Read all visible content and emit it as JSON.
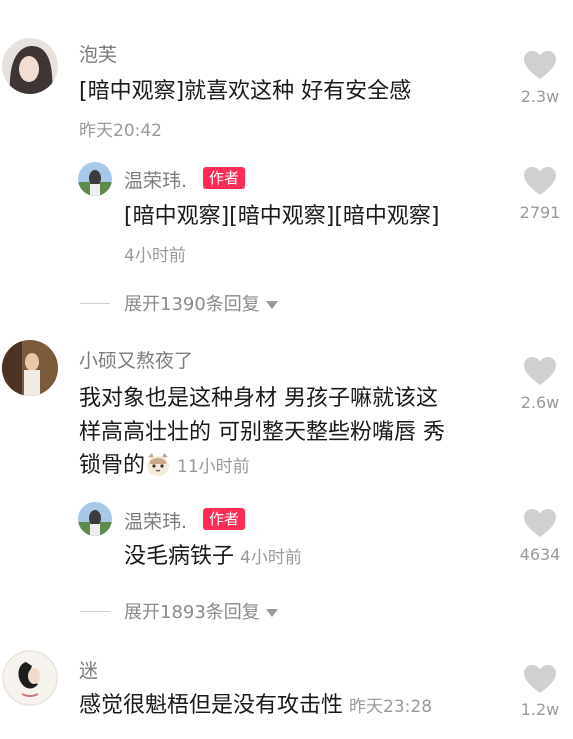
{
  "comments": [
    {
      "user": "泡芙",
      "text": "[暗中观察]就喜欢这种 好有安全感",
      "time": "昨天20:42",
      "likes": "2.3w",
      "reply": {
        "user": "温荣玮.",
        "badge": "作者",
        "text": "[暗中观察][暗中观察][暗中观察]",
        "time": "4小时前",
        "likes": "2791"
      },
      "expand": "展开1390条回复"
    },
    {
      "user": "小硕又熬夜了",
      "text_lines": [
        "我对象也是这种身材 男孩子嘛就该这",
        "样高高壮壮的 可别整天整些粉嘴唇 秀",
        "锁骨的"
      ],
      "emoji": "cat-face-emoji",
      "time": "11小时前",
      "likes": "2.6w",
      "reply": {
        "user": "温荣玮.",
        "badge": "作者",
        "text": "没毛病铁子",
        "time": "4小时前",
        "likes": "4634"
      },
      "expand": "展开1893条回复"
    },
    {
      "user": "迷",
      "text": "感觉很魁梧但是没有攻击性",
      "time": "昨天23:28",
      "likes": "1.2w"
    }
  ],
  "colors": {
    "badge": "#fe2c55",
    "heart": "#cfcfcf"
  }
}
